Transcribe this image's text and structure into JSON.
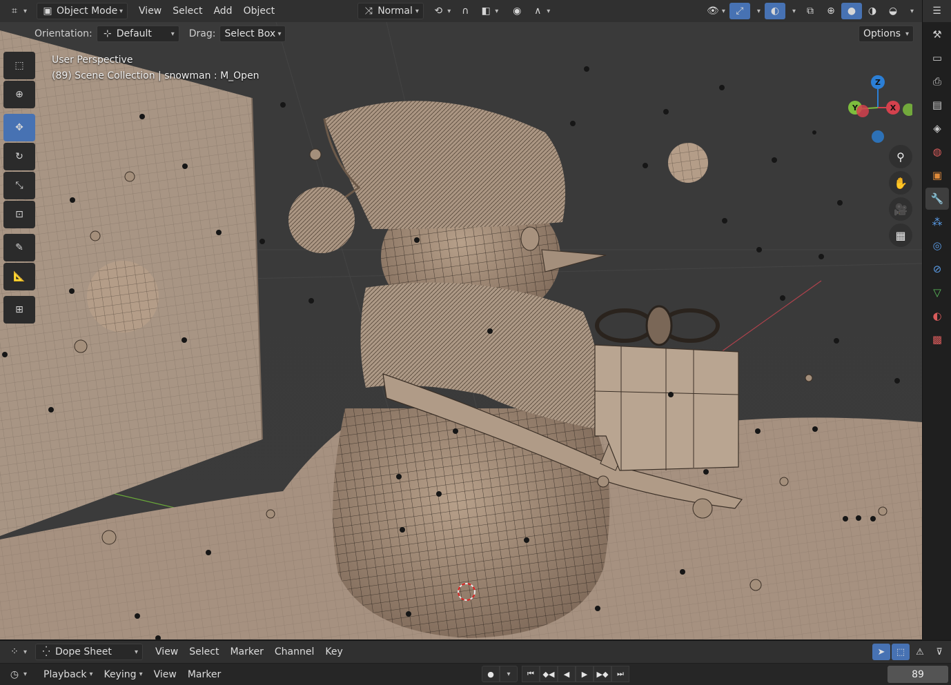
{
  "header": {
    "editor_icon": "3d-viewport-icon",
    "mode": "Object Mode",
    "menus": [
      "View",
      "Select",
      "Add",
      "Object"
    ],
    "transform_orientation": "Normal",
    "options_label": "Options"
  },
  "tool_settings": {
    "orientation_label": "Orientation:",
    "orientation_value": "Default",
    "drag_label": "Drag:",
    "drag_value": "Select Box"
  },
  "viewport": {
    "perspective_label": "User Perspective",
    "collection_label": "(89) Scene Collection | snowman : M_Open"
  },
  "gizmo": {
    "axes": [
      "Z",
      "Y",
      "X"
    ],
    "colors": {
      "x": "#d4414d",
      "y": "#7dbd3d",
      "z": "#2b7fd6"
    }
  },
  "toolbar": {
    "tools": [
      "select-box",
      "cursor",
      "move",
      "rotate",
      "scale",
      "transform",
      "annotate",
      "measure",
      "add-cube"
    ],
    "active": "move"
  },
  "properties_tabs": [
    "tool",
    "render",
    "output",
    "view-layer",
    "scene",
    "world",
    "object",
    "modifiers",
    "particles",
    "physics",
    "constraints",
    "data",
    "material",
    "texture"
  ],
  "dope_sheet": {
    "editor": "Dope Sheet",
    "menus": [
      "View",
      "Select",
      "Marker",
      "Channel",
      "Key"
    ]
  },
  "timeline": {
    "playback_label": "Playback",
    "keying_label": "Keying",
    "menus": [
      "View",
      "Marker"
    ],
    "current_frame": "89"
  },
  "colors": {
    "accent": "#4772b3",
    "header_bg": "#303030",
    "viewport_bg": "#3b3b3b"
  }
}
